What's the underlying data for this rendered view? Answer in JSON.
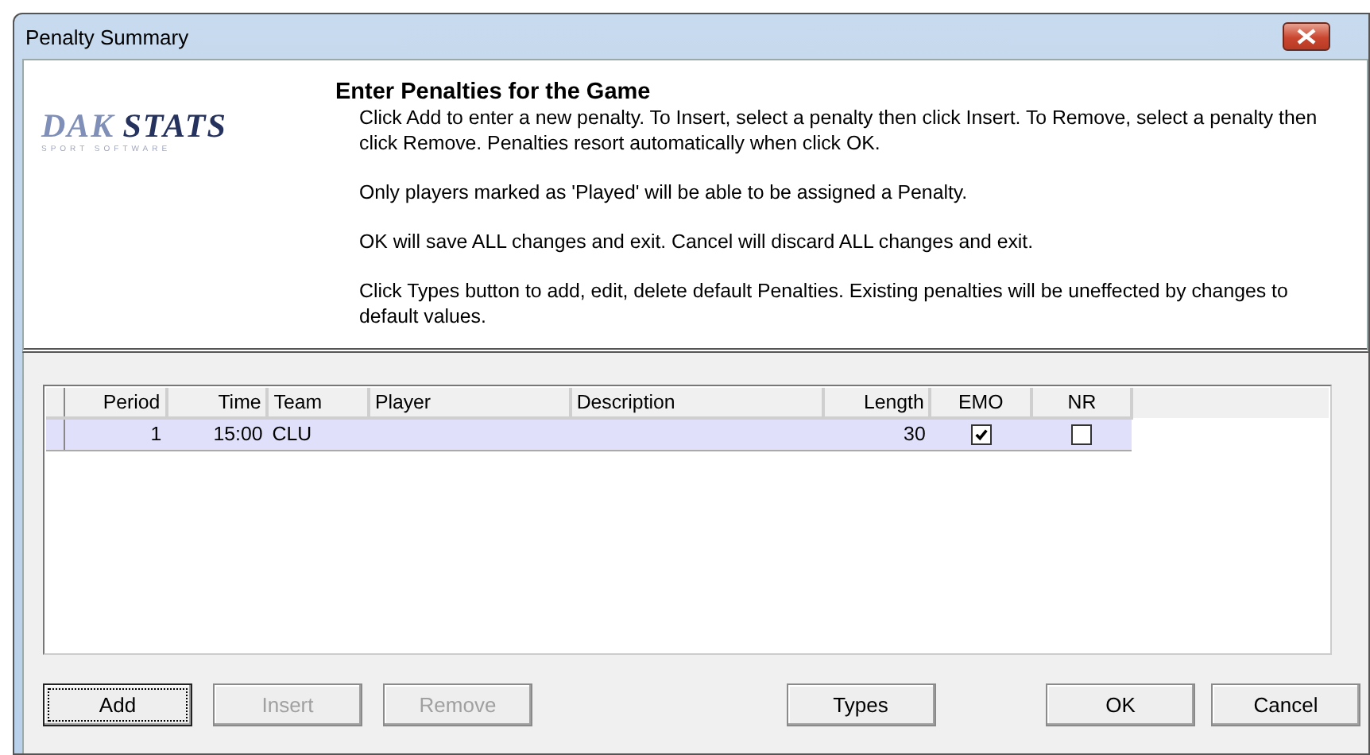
{
  "window": {
    "title": "Penalty Summary"
  },
  "logo": {
    "brand_left": "DAK",
    "brand_right": "STATS",
    "tagline": "SPORT SOFTWARE"
  },
  "header": {
    "heading": "Enter Penalties for the Game",
    "paragraphs": [
      "Click Add to enter a new penalty.  To Insert, select a penalty then click Insert. To Remove, select a penalty then click Remove. Penalties resort automatically when click OK.",
      "Only players marked as 'Played' will be able to be assigned a Penalty.",
      "OK will save ALL changes and exit.  Cancel will discard ALL changes and exit.",
      "Click Types button to add, edit, delete default Penalties. Existing penalties will be uneffected by changes to default values."
    ]
  },
  "table": {
    "columns": [
      {
        "label": "Period",
        "kind": "num"
      },
      {
        "label": "Time",
        "kind": "num"
      },
      {
        "label": "Team",
        "kind": "text"
      },
      {
        "label": "Player",
        "kind": "text"
      },
      {
        "label": "Description",
        "kind": "text"
      },
      {
        "label": "Length",
        "kind": "num"
      },
      {
        "label": "EMO",
        "kind": "check"
      },
      {
        "label": "NR",
        "kind": "check"
      }
    ],
    "rows": [
      {
        "selected": true,
        "cells": [
          "1",
          "15:00",
          "CLU",
          "",
          "",
          "30",
          true,
          false
        ]
      }
    ]
  },
  "button_groups": [
    [
      {
        "label": "Add",
        "disabled": false,
        "focused": true
      },
      {
        "label": "Insert",
        "disabled": true,
        "focused": false
      },
      {
        "label": "Remove",
        "disabled": true,
        "focused": false
      }
    ],
    [
      {
        "label": "Types",
        "disabled": false,
        "focused": false
      }
    ],
    [
      {
        "label": "OK",
        "disabled": false,
        "focused": false
      },
      {
        "label": "Cancel",
        "disabled": false,
        "focused": false
      }
    ]
  ]
}
